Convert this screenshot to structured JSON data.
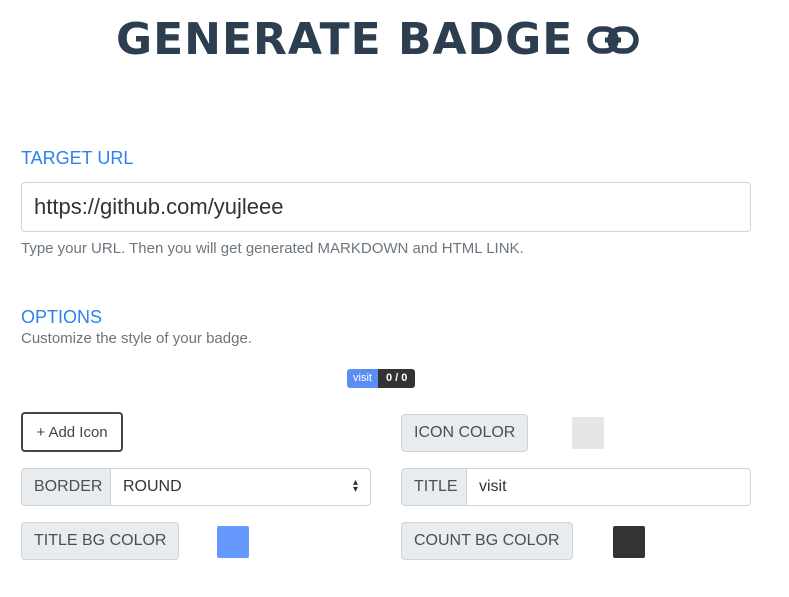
{
  "header": {
    "title": "GENERATE BADGE"
  },
  "target": {
    "label": "TARGET URL",
    "url_value": "https://github.com/yujleee",
    "help": "Type your URL. Then you will get generated MARKDOWN and HTML LINK."
  },
  "options": {
    "label": "OPTIONS",
    "help": "Customize the style of your badge.",
    "preview": {
      "title": "visit",
      "count": "0 / 0"
    },
    "add_icon_label": "+ Add Icon",
    "icon_color_label": "ICON COLOR",
    "icon_color": "#e6e6e6",
    "border_label": "BORDER",
    "border_value": "ROUND",
    "title_label": "TITLE",
    "title_value": "visit",
    "title_bg_label": "TITLE BG COLOR",
    "title_bg_color": "#6699ff",
    "count_bg_label": "COUNT BG COLOR",
    "count_bg_color": "#333333"
  },
  "icons": {
    "header_icon": "link-icon",
    "select_arrow": "select-arrows-icon"
  }
}
